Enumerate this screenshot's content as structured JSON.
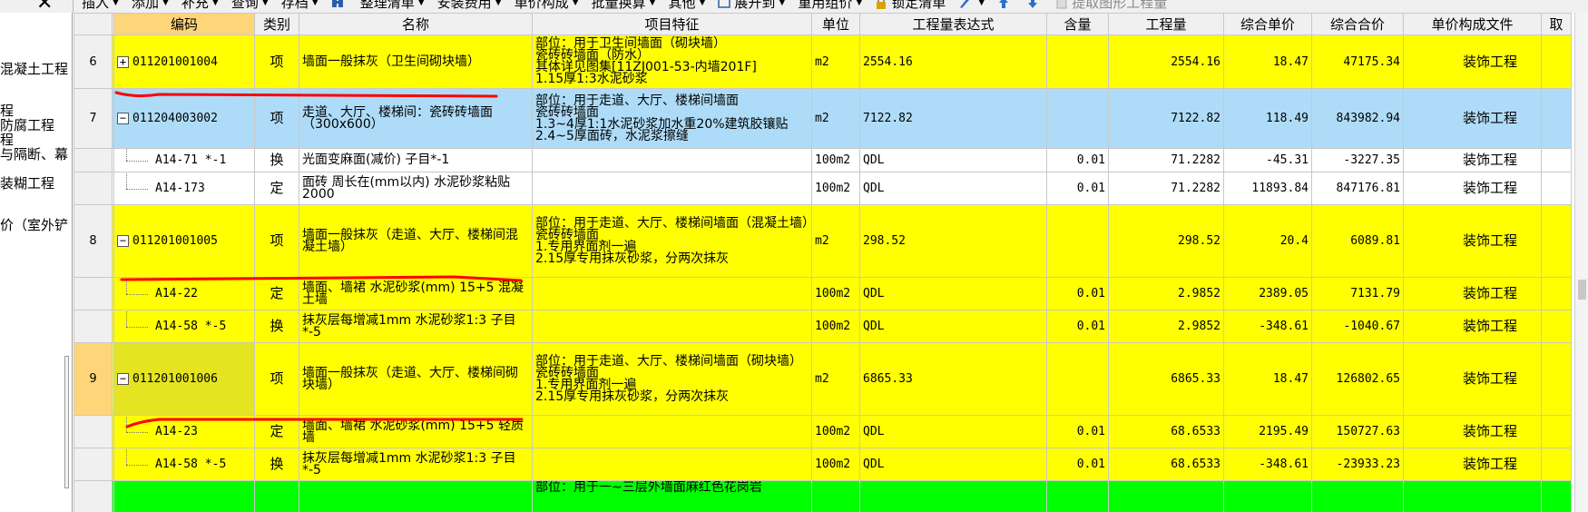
{
  "toolbar": {
    "close_symbol": "✕",
    "items": [
      "插入",
      "添加",
      "补充",
      "查询",
      "存档",
      "",
      "整理清单",
      "安装费用",
      "单价构成",
      "批量换算",
      "其他",
      "展开到",
      "重用组价",
      "锁定清单",
      "",
      "",
      "",
      "提取图形工程量"
    ]
  },
  "left_panel": {
    "items": [
      "混凝土工程",
      "程",
      "防腐工程",
      "程",
      "与隔断、幕",
      "装糊工程",
      "价（室外铲"
    ]
  },
  "table": {
    "headers": [
      "编码",
      "类别",
      "名称",
      "项目特征",
      "单位",
      "工程量表达式",
      "含量",
      "工程量",
      "综合单价",
      "综合合价",
      "单价构成文件",
      "取"
    ],
    "rows": [
      {
        "idx": "6",
        "color": "yellow",
        "kind": "item",
        "expander": "+",
        "code": "011201001004",
        "type": "项",
        "name": "墙面一般抹灰（卫生间砌块墙）",
        "features": [
          "部位：用于卫生间墙面（砌块墙）",
          "瓷砖砖墙面（防水）",
          "其体详见图集[11ZJ001-53-内墙201F]",
          "1.15厚1:3水泥砂浆"
        ],
        "unit": "m2",
        "expr": "2554.16",
        "content": "",
        "qty": "2554.16",
        "unit_price": "18.47",
        "total": "47175.34",
        "file": "装饰工程"
      },
      {
        "idx": "7",
        "color": "blue",
        "kind": "item",
        "expander": "−",
        "code": "011204003002",
        "type": "项",
        "name": "走道、大厅、楼梯间：瓷砖砖墙面（300x600）",
        "features": [
          "部位：用于走道、大厅、楼梯间墙面",
          "瓷砖砖墙面",
          "1.3~4厚1:1水泥砂浆加水重20%建筑胶镶贴",
          "2.4~5厚面砖，水泥浆擦缝"
        ],
        "unit": "m2",
        "expr": "7122.82",
        "content": "",
        "qty": "7122.82",
        "unit_price": "118.49",
        "total": "843982.94",
        "file": "装饰工程"
      },
      {
        "idx": "",
        "color": "white",
        "kind": "sub",
        "code": "A14-71 *-1",
        "type": "换",
        "name": "光面变麻面(减价) 子目*-1",
        "features": [],
        "unit": "100m2",
        "expr": "QDL",
        "content": "0.01",
        "qty": "71.2282",
        "unit_price": "-45.31",
        "total": "-3227.35",
        "file": "装饰工程"
      },
      {
        "idx": "",
        "color": "white",
        "kind": "sub",
        "code": "A14-173",
        "type": "定",
        "name": "面砖 周长在(mm以内) 水泥砂浆粘贴 2000",
        "features": [],
        "unit": "100m2",
        "expr": "QDL",
        "content": "0.01",
        "qty": "71.2282",
        "unit_price": "11893.84",
        "total": "847176.81",
        "file": "装饰工程"
      },
      {
        "idx": "8",
        "color": "yellow",
        "kind": "item",
        "expander": "−",
        "code": "011201001005",
        "type": "项",
        "name": "墙面一般抹灰（走道、大厅、楼梯间混凝土墙）",
        "features": [
          "部位：用于走道、大厅、楼梯间墙面（混凝土墙）",
          "瓷砖砖墙面",
          "1.专用界面剂一遍",
          "2.15厚专用抹灰砂浆，分两次抹灰"
        ],
        "unit": "m2",
        "expr": "298.52",
        "content": "",
        "qty": "298.52",
        "unit_price": "20.4",
        "total": "6089.81",
        "file": "装饰工程"
      },
      {
        "idx": "",
        "color": "yellow",
        "kind": "sub",
        "code": "A14-22",
        "type": "定",
        "name": "墙面、墙裙 水泥砂浆(mm) 15+5 混凝土墙",
        "features": [],
        "unit": "100m2",
        "expr": "QDL",
        "content": "0.01",
        "qty": "2.9852",
        "unit_price": "2389.05",
        "total": "7131.79",
        "file": "装饰工程"
      },
      {
        "idx": "",
        "color": "yellow",
        "kind": "sub",
        "code": "A14-58 *-5",
        "type": "换",
        "name": "抹灰层每增减1mm 水泥砂浆1:3 子目*-5",
        "features": [],
        "unit": "100m2",
        "expr": "QDL",
        "content": "0.01",
        "qty": "2.9852",
        "unit_price": "-348.61",
        "total": "-1040.67",
        "file": "装饰工程"
      },
      {
        "idx": "9",
        "color": "yellow",
        "kind": "item",
        "selected": true,
        "expander": "−",
        "code": "011201001006",
        "type": "项",
        "name": "墙面一般抹灰（走道、大厅、楼梯间砌块墙）",
        "features": [
          "部位：用于走道、大厅、楼梯间墙面（砌块墙）",
          "瓷砖砖墙面",
          "1.专用界面剂一遍",
          "2.15厚专用抹灰砂浆，分两次抹灰"
        ],
        "unit": "m2",
        "expr": "6865.33",
        "content": "",
        "qty": "6865.33",
        "unit_price": "18.47",
        "total": "126802.65",
        "file": "装饰工程"
      },
      {
        "idx": "",
        "color": "yellow",
        "kind": "sub",
        "code": "A14-23",
        "type": "定",
        "name": "墙面、墙裙 水泥砂浆(mm) 15+5 轻质墙",
        "features": [],
        "unit": "100m2",
        "expr": "QDL",
        "content": "0.01",
        "qty": "68.6533",
        "unit_price": "2195.49",
        "total": "150727.63",
        "file": "装饰工程"
      },
      {
        "idx": "",
        "color": "yellow",
        "kind": "sub",
        "code": "A14-58 *-5",
        "type": "换",
        "name": "抹灰层每增减1mm 水泥砂浆1:3 子目*-5",
        "features": [],
        "unit": "100m2",
        "expr": "QDL",
        "content": "0.01",
        "qty": "68.6533",
        "unit_price": "-348.61",
        "total": "-23933.23",
        "file": "装饰工程"
      },
      {
        "idx": "",
        "color": "green",
        "kind": "item",
        "code": "",
        "type": "",
        "name": "",
        "features": [
          "部位：用于一~三层外墙面麻红色花岗岩"
        ],
        "unit": "",
        "expr": "",
        "content": "",
        "qty": "",
        "unit_price": "",
        "total": "",
        "file": ""
      }
    ]
  },
  "colors": {
    "yellow_row": "#ffff00",
    "blue_row": "#aedcf8",
    "green_row": "#00ff00",
    "code_header": "#ffd57a",
    "annotation_stroke": "#ff0000"
  }
}
